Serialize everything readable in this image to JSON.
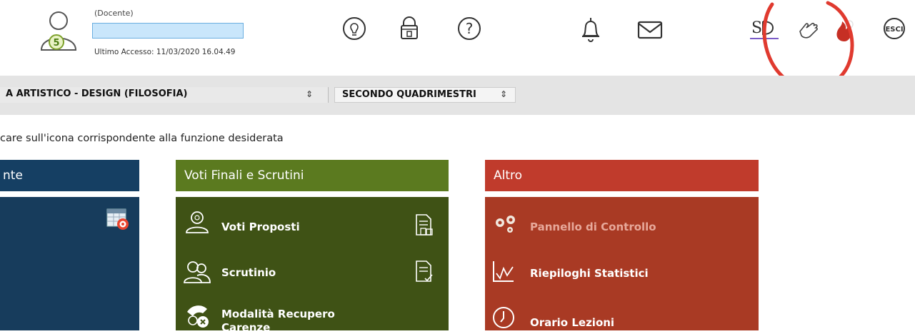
{
  "header": {
    "role": "(Docente)",
    "name": "",
    "last_access": "Ultimo Accesso: 11/03/2020 16.04.49",
    "avatar_badge": "5",
    "esci_label": "ESCI",
    "icons": [
      "avatar-icon",
      "lightbulb-icon",
      "lock-icon",
      "help-icon",
      "bell-icon",
      "mail-icon",
      "signature-icon",
      "hand-icon",
      "flame-icon",
      "logout-icon"
    ],
    "highlight_color": "#e03a2f"
  },
  "toolbar": {
    "class_select": "A ARTISTICO - DESIGN (FILOSOFIA)",
    "period_select": "SECONDO QUADRIMESTRI"
  },
  "instructions": "care sull'icona corrispondente alla funzione desiderata",
  "panels": [
    {
      "title": "nte",
      "color": "#153f63",
      "items": []
    },
    {
      "title": "Voti Finali e Scrutini",
      "color": "#5b7a1f",
      "items": [
        {
          "label": "Voti Proposti"
        },
        {
          "label": "Scrutinio"
        },
        {
          "label": "Modalità Recupero",
          "label2": "Carenze"
        }
      ]
    },
    {
      "title": "Altro",
      "color": "#c03b2c",
      "items": [
        {
          "label": "Pannello di Controllo"
        },
        {
          "label": "Riepiloghi Statistici"
        },
        {
          "label": "Orario Lezioni"
        }
      ]
    }
  ]
}
